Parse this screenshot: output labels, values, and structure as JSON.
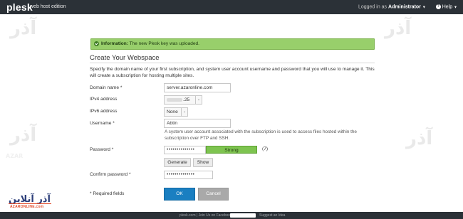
{
  "topbar": {
    "logo": "plesk",
    "edition": "web host edition",
    "logged_in_as": "Logged in as",
    "user": "Administrator",
    "help": "Help"
  },
  "watermark": {
    "brand": "آذر",
    "brand_latin": "AZAR"
  },
  "notice": {
    "label": "Information:",
    "text": "The new Plesk key was uploaded."
  },
  "form": {
    "title": "Create Your Webspace",
    "description": "Specify the domain name of your first subscription, and system user account username and password that you will use to manage it. This will create a subscription for hosting multiple sites.",
    "domain_label": "Domain name *",
    "domain_value": "server.azaronline.com",
    "ipv4_label": "IPv4 address",
    "ipv4_value": ".25",
    "ipv6_label": "IPv6 address",
    "ipv6_value": "None",
    "username_label": "Username *",
    "username_value": "Abtin",
    "username_hint": "A system user account associated with the subscription is used to access files hosted within the subscription over FTP and SSH.",
    "password_label": "Password *",
    "password_value": "••••••••••••••",
    "strength": "Strong",
    "strength_count": "(7)",
    "generate": "Generate",
    "show": "Show",
    "confirm_label": "Confirm password *",
    "confirm_value": "••••••••••••••",
    "required_note": "* Required fields",
    "ok": "OK",
    "cancel": "Cancel"
  },
  "brand": {
    "name": "آذر آنلاین",
    "latin": "AZARONLINE.com"
  },
  "footer": {
    "left": "plesk.com | Join Us on Facebook",
    "right": "Suggest an Idea"
  },
  "colors": {
    "topbar": "#2b3137",
    "success": "#98cf6b",
    "primary": "#1a7fc1",
    "strength": "#7ec450"
  }
}
